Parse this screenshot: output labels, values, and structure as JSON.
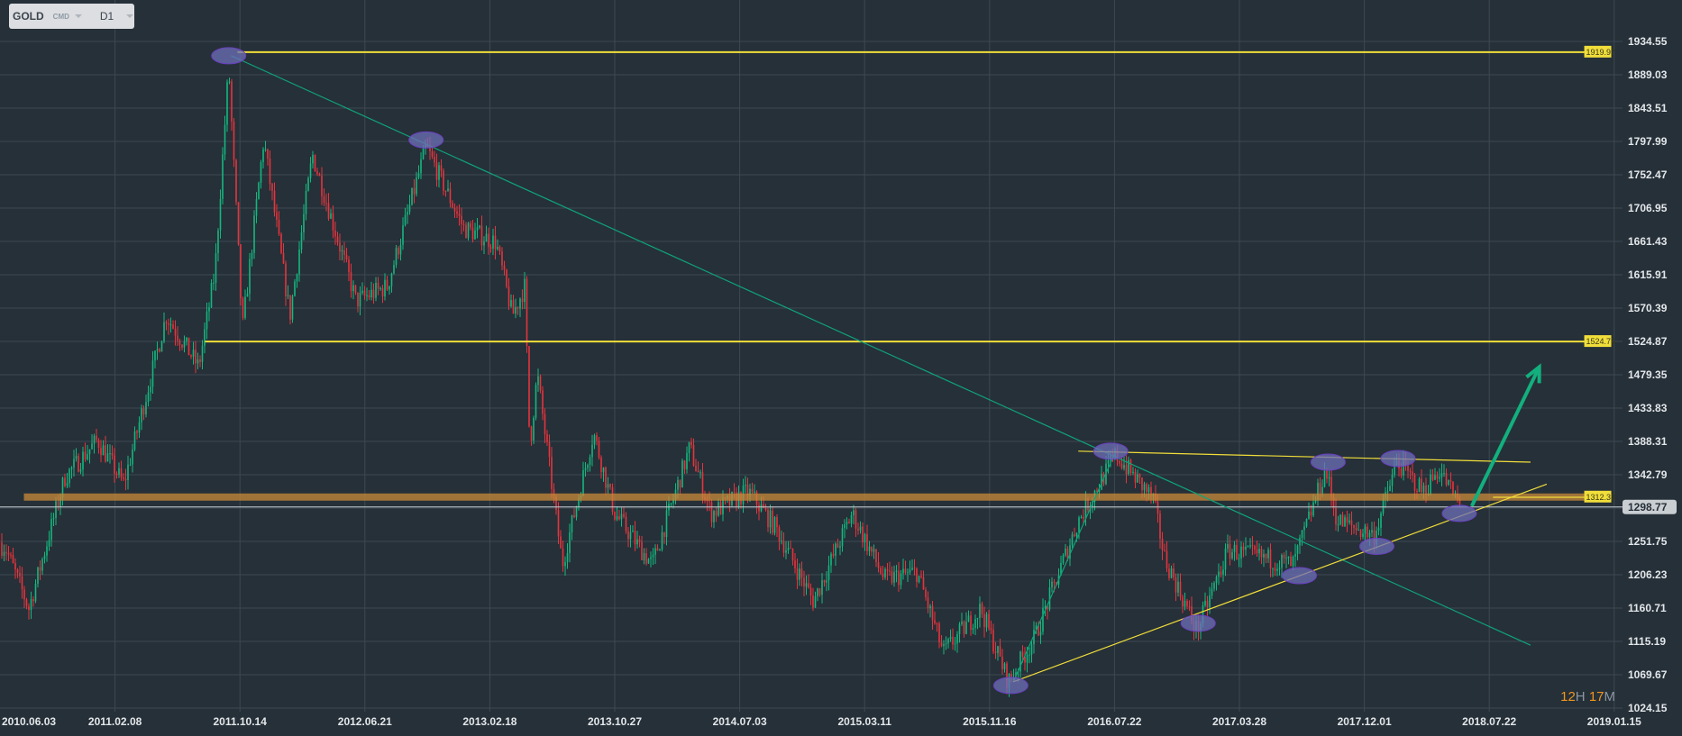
{
  "toolbar": {
    "symbol": "GOLD",
    "category": "CMD",
    "timeframe": "D1"
  },
  "timer": {
    "hours": "12",
    "h_unit": "H",
    "minutes": "17",
    "m_unit": "M"
  },
  "colors": {
    "background": "#263038",
    "grid": "#3d4952",
    "up": "#14b77f",
    "down": "#e5343d",
    "level": "#f1de3a",
    "band": "#c98a3a",
    "trend": "#0fa37a",
    "ellipse": "#6d6fb8",
    "arrow": "#12b07e"
  },
  "chart_data": {
    "type": "candlestick",
    "title": "GOLD D1",
    "y_ticks": [
      "1934.55",
      "1889.03",
      "1843.51",
      "1797.99",
      "1752.47",
      "1706.95",
      "1661.43",
      "1615.91",
      "1570.39",
      "1524.87",
      "1479.35",
      "1433.83",
      "1388.31",
      "1342.79",
      "1251.75",
      "1206.23",
      "1160.71",
      "1115.19",
      "1069.67",
      "1024.15"
    ],
    "ylim": [
      1024.15,
      1934.55
    ],
    "x_ticks": [
      "2010.06.03",
      "2011.02.08",
      "2011.10.14",
      "2012.06.21",
      "2013.02.18",
      "2013.10.27",
      "2014.07.03",
      "2015.03.11",
      "2015.11.16",
      "2016.07.22",
      "2017.03.28",
      "2017.12.01",
      "2018.07.22",
      "2019.01.15"
    ],
    "current_price": "1298.77",
    "price_path": [
      [
        0,
        1250
      ],
      [
        0.12,
        1245
      ],
      [
        0.31,
        1160
      ],
      [
        0.6,
        1340
      ],
      [
        0.86,
        1390
      ],
      [
        1.07,
        1330
      ],
      [
        1.41,
        1560
      ],
      [
        1.67,
        1490
      ],
      [
        1.8,
        1620
      ],
      [
        1.91,
        1900
      ],
      [
        2.02,
        1540
      ],
      [
        2.19,
        1800
      ],
      [
        2.4,
        1560
      ],
      [
        2.58,
        1780
      ],
      [
        2.93,
        1580
      ],
      [
        3.18,
        1600
      ],
      [
        3.49,
        1790
      ],
      [
        3.79,
        1680
      ],
      [
        4.05,
        1660
      ],
      [
        4.18,
        1560
      ],
      [
        4.28,
        1600
      ],
      [
        4.32,
        1380
      ],
      [
        4.38,
        1480
      ],
      [
        4.58,
        1220
      ],
      [
        4.83,
        1400
      ],
      [
        5.0,
        1290
      ],
      [
        5.3,
        1220
      ],
      [
        5.6,
        1380
      ],
      [
        5.77,
        1290
      ],
      [
        6.07,
        1320
      ],
      [
        6.29,
        1270
      ],
      [
        6.59,
        1170
      ],
      [
        6.9,
        1290
      ],
      [
        7.16,
        1200
      ],
      [
        7.42,
        1210
      ],
      [
        7.63,
        1100
      ],
      [
        7.93,
        1160
      ],
      [
        8.15,
        1060
      ],
      [
        8.36,
        1120
      ],
      [
        8.71,
        1280
      ],
      [
        9.01,
        1370
      ],
      [
        9.31,
        1310
      ],
      [
        9.4,
        1230
      ],
      [
        9.66,
        1130
      ],
      [
        9.91,
        1240
      ],
      [
        10.43,
        1220
      ],
      [
        10.69,
        1350
      ],
      [
        10.78,
        1280
      ],
      [
        11.08,
        1260
      ],
      [
        11.26,
        1360
      ],
      [
        11.47,
        1320
      ],
      [
        11.6,
        1350
      ],
      [
        11.77,
        1299
      ]
    ],
    "levels": [
      {
        "label": "1919.97",
        "price": 1919.97,
        "from": 1.98
      },
      {
        "label": "1524.76",
        "price": 1524.76,
        "from": 1.72
      },
      {
        "label": "1312.33",
        "price": 1312.33,
        "from": 0.35
      }
    ],
    "trendlines": [
      {
        "name": "downtrend-line",
        "kind": "trend",
        "p1": [
          1.93,
          1915
        ],
        "p2": [
          12.33,
          1110
        ]
      },
      {
        "name": "breakout-leg-line",
        "kind": "trend",
        "p1": [
          8.19,
          1060
        ],
        "p2": [
          9.01,
          1375
        ]
      },
      {
        "name": "rising-support-line",
        "kind": "level",
        "p1": [
          8.19,
          1060
        ],
        "p2": [
          12.46,
          1330
        ]
      },
      {
        "name": "resistance-top-line",
        "kind": "level",
        "p1": [
          8.71,
          1375
        ],
        "p2": [
          12.33,
          1360
        ]
      },
      {
        "name": "short-level-line",
        "kind": "level",
        "p1": [
          12.03,
          1312
        ],
        "p2": [
          12.76,
          1312
        ]
      }
    ],
    "arrow": {
      "from": [
        11.86,
        1300
      ],
      "to": [
        12.4,
        1490
      ]
    },
    "ellipses": [
      [
        1.91,
        1915
      ],
      [
        3.49,
        1800
      ],
      [
        8.97,
        1375
      ],
      [
        8.17,
        1055
      ],
      [
        9.67,
        1140
      ],
      [
        10.48,
        1205
      ],
      [
        10.71,
        1360
      ],
      [
        11.1,
        1245
      ],
      [
        11.27,
        1365
      ],
      [
        11.76,
        1290
      ]
    ]
  }
}
